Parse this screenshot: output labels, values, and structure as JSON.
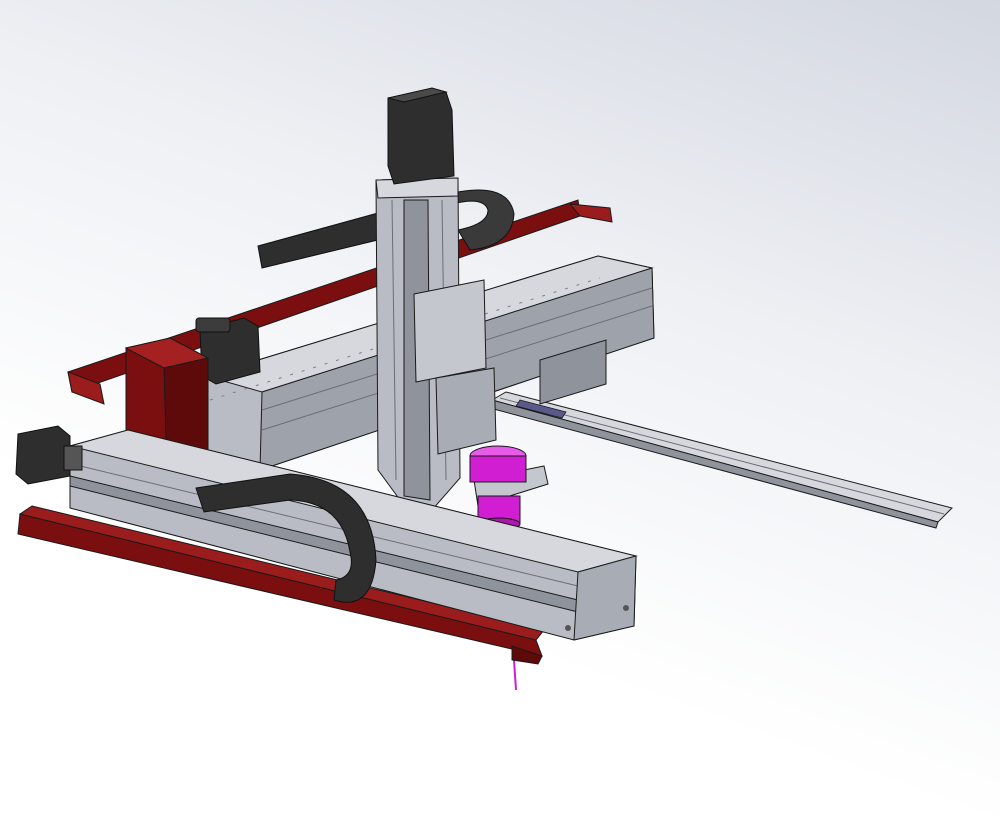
{
  "view": {
    "type": "cad-3d-viewport",
    "background": {
      "top": "#d3d7e0",
      "bottom": "#ffffff"
    }
  },
  "model": {
    "colors": {
      "aluminum": "#b9bcc4",
      "aluminum_dark": "#8e939c",
      "aluminum_light": "#d6d8de",
      "motor": "#2e2e2e",
      "frame_red": "#7b0f0f",
      "frame_red_light": "#9b1c1c",
      "cable_chain": "#3a3a3a",
      "tool_magenta": "#d21ed2",
      "outline": "#1a1a1a"
    },
    "parts": [
      "z-axis-servo-motor",
      "z-axis-linear-module",
      "y-axis-linear-module",
      "y-axis-servo-motor",
      "x-axis-linear-module",
      "x-axis-stepper-motor",
      "red-frame-rail-front",
      "red-frame-rail-rear",
      "control-box",
      "cable-chain-front",
      "cable-chain-top",
      "guide-rail",
      "tool-spindle",
      "tool-mount-bracket"
    ]
  }
}
